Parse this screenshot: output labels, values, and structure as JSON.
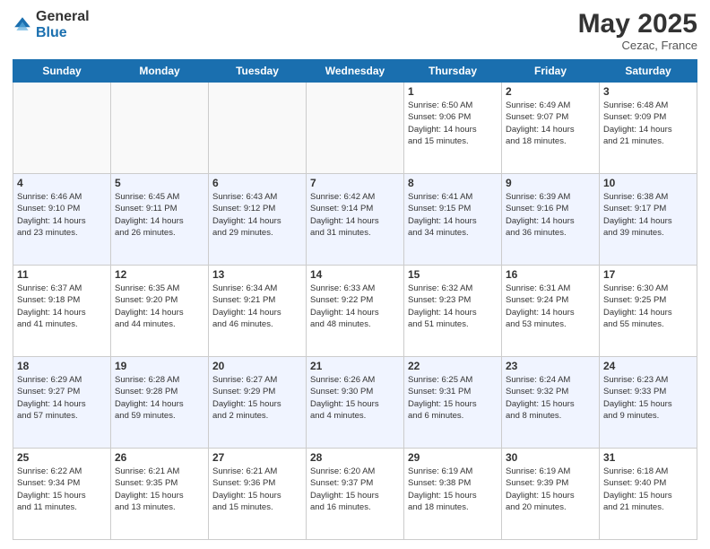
{
  "header": {
    "logo_general": "General",
    "logo_blue": "Blue",
    "month_title": "May 2025",
    "location": "Cezac, France"
  },
  "calendar": {
    "days_of_week": [
      "Sunday",
      "Monday",
      "Tuesday",
      "Wednesday",
      "Thursday",
      "Friday",
      "Saturday"
    ],
    "weeks": [
      [
        {
          "day": "",
          "info": ""
        },
        {
          "day": "",
          "info": ""
        },
        {
          "day": "",
          "info": ""
        },
        {
          "day": "",
          "info": ""
        },
        {
          "day": "1",
          "info": "Sunrise: 6:50 AM\nSunset: 9:06 PM\nDaylight: 14 hours\nand 15 minutes."
        },
        {
          "day": "2",
          "info": "Sunrise: 6:49 AM\nSunset: 9:07 PM\nDaylight: 14 hours\nand 18 minutes."
        },
        {
          "day": "3",
          "info": "Sunrise: 6:48 AM\nSunset: 9:09 PM\nDaylight: 14 hours\nand 21 minutes."
        }
      ],
      [
        {
          "day": "4",
          "info": "Sunrise: 6:46 AM\nSunset: 9:10 PM\nDaylight: 14 hours\nand 23 minutes."
        },
        {
          "day": "5",
          "info": "Sunrise: 6:45 AM\nSunset: 9:11 PM\nDaylight: 14 hours\nand 26 minutes."
        },
        {
          "day": "6",
          "info": "Sunrise: 6:43 AM\nSunset: 9:12 PM\nDaylight: 14 hours\nand 29 minutes."
        },
        {
          "day": "7",
          "info": "Sunrise: 6:42 AM\nSunset: 9:14 PM\nDaylight: 14 hours\nand 31 minutes."
        },
        {
          "day": "8",
          "info": "Sunrise: 6:41 AM\nSunset: 9:15 PM\nDaylight: 14 hours\nand 34 minutes."
        },
        {
          "day": "9",
          "info": "Sunrise: 6:39 AM\nSunset: 9:16 PM\nDaylight: 14 hours\nand 36 minutes."
        },
        {
          "day": "10",
          "info": "Sunrise: 6:38 AM\nSunset: 9:17 PM\nDaylight: 14 hours\nand 39 minutes."
        }
      ],
      [
        {
          "day": "11",
          "info": "Sunrise: 6:37 AM\nSunset: 9:18 PM\nDaylight: 14 hours\nand 41 minutes."
        },
        {
          "day": "12",
          "info": "Sunrise: 6:35 AM\nSunset: 9:20 PM\nDaylight: 14 hours\nand 44 minutes."
        },
        {
          "day": "13",
          "info": "Sunrise: 6:34 AM\nSunset: 9:21 PM\nDaylight: 14 hours\nand 46 minutes."
        },
        {
          "day": "14",
          "info": "Sunrise: 6:33 AM\nSunset: 9:22 PM\nDaylight: 14 hours\nand 48 minutes."
        },
        {
          "day": "15",
          "info": "Sunrise: 6:32 AM\nSunset: 9:23 PM\nDaylight: 14 hours\nand 51 minutes."
        },
        {
          "day": "16",
          "info": "Sunrise: 6:31 AM\nSunset: 9:24 PM\nDaylight: 14 hours\nand 53 minutes."
        },
        {
          "day": "17",
          "info": "Sunrise: 6:30 AM\nSunset: 9:25 PM\nDaylight: 14 hours\nand 55 minutes."
        }
      ],
      [
        {
          "day": "18",
          "info": "Sunrise: 6:29 AM\nSunset: 9:27 PM\nDaylight: 14 hours\nand 57 minutes."
        },
        {
          "day": "19",
          "info": "Sunrise: 6:28 AM\nSunset: 9:28 PM\nDaylight: 14 hours\nand 59 minutes."
        },
        {
          "day": "20",
          "info": "Sunrise: 6:27 AM\nSunset: 9:29 PM\nDaylight: 15 hours\nand 2 minutes."
        },
        {
          "day": "21",
          "info": "Sunrise: 6:26 AM\nSunset: 9:30 PM\nDaylight: 15 hours\nand 4 minutes."
        },
        {
          "day": "22",
          "info": "Sunrise: 6:25 AM\nSunset: 9:31 PM\nDaylight: 15 hours\nand 6 minutes."
        },
        {
          "day": "23",
          "info": "Sunrise: 6:24 AM\nSunset: 9:32 PM\nDaylight: 15 hours\nand 8 minutes."
        },
        {
          "day": "24",
          "info": "Sunrise: 6:23 AM\nSunset: 9:33 PM\nDaylight: 15 hours\nand 9 minutes."
        }
      ],
      [
        {
          "day": "25",
          "info": "Sunrise: 6:22 AM\nSunset: 9:34 PM\nDaylight: 15 hours\nand 11 minutes."
        },
        {
          "day": "26",
          "info": "Sunrise: 6:21 AM\nSunset: 9:35 PM\nDaylight: 15 hours\nand 13 minutes."
        },
        {
          "day": "27",
          "info": "Sunrise: 6:21 AM\nSunset: 9:36 PM\nDaylight: 15 hours\nand 15 minutes."
        },
        {
          "day": "28",
          "info": "Sunrise: 6:20 AM\nSunset: 9:37 PM\nDaylight: 15 hours\nand 16 minutes."
        },
        {
          "day": "29",
          "info": "Sunrise: 6:19 AM\nSunset: 9:38 PM\nDaylight: 15 hours\nand 18 minutes."
        },
        {
          "day": "30",
          "info": "Sunrise: 6:19 AM\nSunset: 9:39 PM\nDaylight: 15 hours\nand 20 minutes."
        },
        {
          "day": "31",
          "info": "Sunrise: 6:18 AM\nSunset: 9:40 PM\nDaylight: 15 hours\nand 21 minutes."
        }
      ]
    ]
  }
}
